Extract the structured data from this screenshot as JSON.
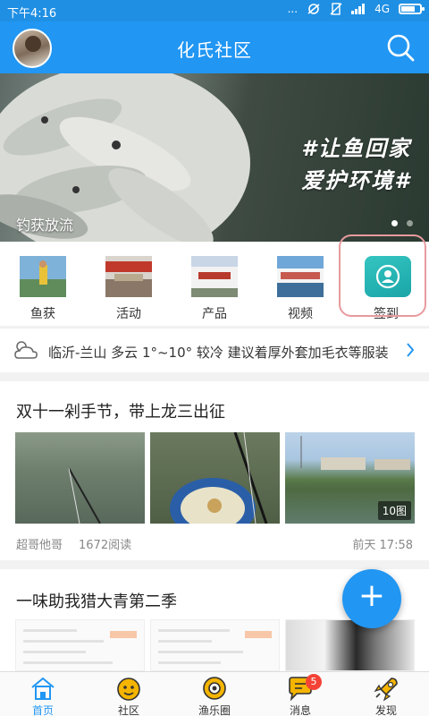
{
  "status_bar": {
    "time": "下午4:16",
    "signal_dots": "...",
    "network": "4G"
  },
  "header": {
    "title": "化氏社区"
  },
  "banner": {
    "slogan_line1": "#让鱼回家",
    "slogan_line2": "爱护环境#",
    "caption": "钓获放流",
    "page_count": 2,
    "active_page": 1
  },
  "quick_links": [
    {
      "label": "鱼获",
      "icon": "fishing-photo-icon"
    },
    {
      "label": "活动",
      "icon": "event-photo-icon"
    },
    {
      "label": "产品",
      "icon": "product-photo-icon"
    },
    {
      "label": "视频",
      "icon": "video-photo-icon"
    },
    {
      "label": "签到",
      "icon": "sign-in-icon"
    }
  ],
  "weather": {
    "text": "临沂-兰山 多云 1°~10° 较冷 建议着厚外套加毛衣等服装"
  },
  "posts": [
    {
      "title": "双十一剁手节，带上龙三出征",
      "author": "超哥他哥",
      "reads": "1672阅读",
      "time": "前天 17:58",
      "image_count": "10图"
    },
    {
      "title": "一味助我猎大青第二季"
    }
  ],
  "fab": {
    "label": "+"
  },
  "tabs": [
    {
      "label": "首页",
      "icon": "home-icon",
      "active": true
    },
    {
      "label": "社区",
      "icon": "community-icon",
      "active": false
    },
    {
      "label": "渔乐圈",
      "icon": "fishing-circle-icon",
      "active": false
    },
    {
      "label": "消息",
      "icon": "message-icon",
      "active": false,
      "badge": "5"
    },
    {
      "label": "发现",
      "icon": "discover-icon",
      "active": false
    }
  ],
  "colors": {
    "primary": "#2196f3",
    "signin_accent": "#1aa5a8",
    "badge": "#f44336",
    "tab_icon": "#f4b400"
  }
}
